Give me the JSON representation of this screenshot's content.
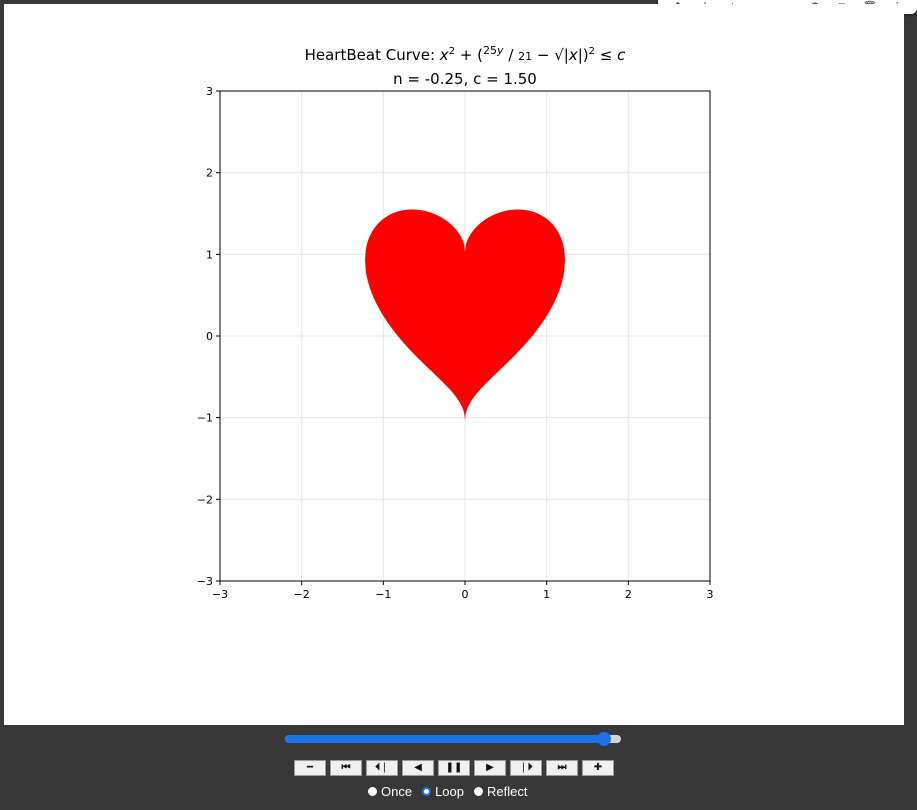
{
  "toolbar": {
    "icons": [
      "arrow-up-icon",
      "arrow-down-icon",
      "sparkle-icon",
      "link-icon",
      "comment-icon",
      "gear-icon",
      "external-icon",
      "trash-icon",
      "more-icon"
    ]
  },
  "figure": {
    "title_prefix": "HeartBeat Curve: ",
    "subtitle": "n = -0.25, c = 1.50",
    "heart_color": "#ff0000"
  },
  "chart_data": {
    "type": "area",
    "title": "HeartBeat Curve: x² + (25y/21 − √|x|)² ≤ c",
    "subtitle": "n = -0.25, c = 1.50",
    "xlim": [
      -3,
      3
    ],
    "ylim": [
      -3,
      3
    ],
    "x_ticks": [
      "−3",
      "−2",
      "−1",
      "0",
      "1",
      "2",
      "3"
    ],
    "y_ticks": [
      "−3",
      "−2",
      "−1",
      "0",
      "1",
      "2",
      "3"
    ],
    "grid": true,
    "region": {
      "n": -0.25,
      "c": 1.5,
      "color": "#ff0000"
    }
  },
  "player": {
    "slider_value": 0.95,
    "accent_color": "#1a73e8",
    "buttons": [
      {
        "name": "decrease-speed-button",
        "glyph": "━"
      },
      {
        "name": "first-frame-button",
        "glyph": "⏮"
      },
      {
        "name": "step-back-button",
        "glyph": "⏴❘"
      },
      {
        "name": "play-reverse-button",
        "glyph": "◀"
      },
      {
        "name": "pause-button",
        "glyph": "❚❚"
      },
      {
        "name": "play-button",
        "glyph": "▶"
      },
      {
        "name": "step-forward-button",
        "glyph": "❘⏵"
      },
      {
        "name": "last-frame-button",
        "glyph": "⏭"
      },
      {
        "name": "increase-speed-button",
        "glyph": "✚"
      }
    ],
    "modes": [
      {
        "label": "Once",
        "checked": false
      },
      {
        "label": "Loop",
        "checked": true
      },
      {
        "label": "Reflect",
        "checked": false
      }
    ]
  }
}
